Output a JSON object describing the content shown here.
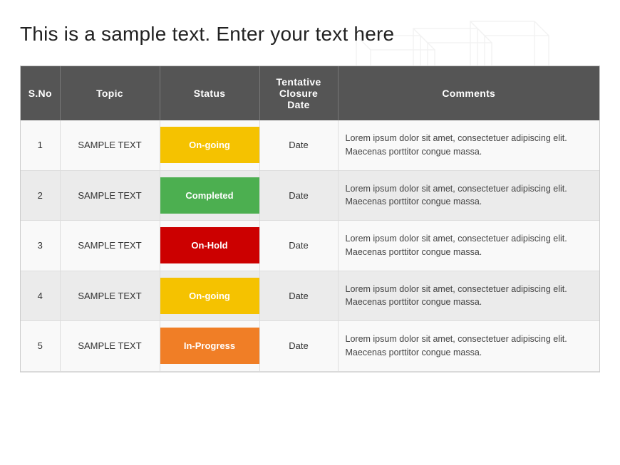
{
  "title": "This is a sample text. Enter your text here",
  "table": {
    "headers": {
      "sno": "S.No",
      "topic": "Topic",
      "status": "Status",
      "date": "Tentative Closure Date",
      "comments": "Comments"
    },
    "rows": [
      {
        "sno": "1",
        "topic": "SAMPLE TEXT",
        "status": "On-going",
        "status_type": "ongoing",
        "date": "Date",
        "comments": "Lorem ipsum dolor sit amet, consectetuer adipiscing elit. Maecenas porttitor congue massa."
      },
      {
        "sno": "2",
        "topic": "SAMPLE TEXT",
        "status": "Completed",
        "status_type": "completed",
        "date": "Date",
        "comments": "Lorem ipsum dolor sit amet, consectetuer adipiscing elit. Maecenas porttitor congue massa."
      },
      {
        "sno": "3",
        "topic": "SAMPLE TEXT",
        "status": "On-Hold",
        "status_type": "onhold",
        "date": "Date",
        "comments": "Lorem ipsum dolor sit amet, consectetuer adipiscing elit. Maecenas porttitor congue massa."
      },
      {
        "sno": "4",
        "topic": "SAMPLE TEXT",
        "status": "On-going",
        "status_type": "ongoing",
        "date": "Date",
        "comments": "Lorem ipsum dolor sit amet, consectetuer adipiscing elit. Maecenas porttitor congue massa."
      },
      {
        "sno": "5",
        "topic": "SAMPLE TEXT",
        "status": "In-Progress",
        "status_type": "inprogress",
        "date": "Date",
        "comments": "Lorem ipsum dolor sit amet, consectetuer adipiscing elit. Maecenas porttitor congue massa."
      }
    ]
  }
}
